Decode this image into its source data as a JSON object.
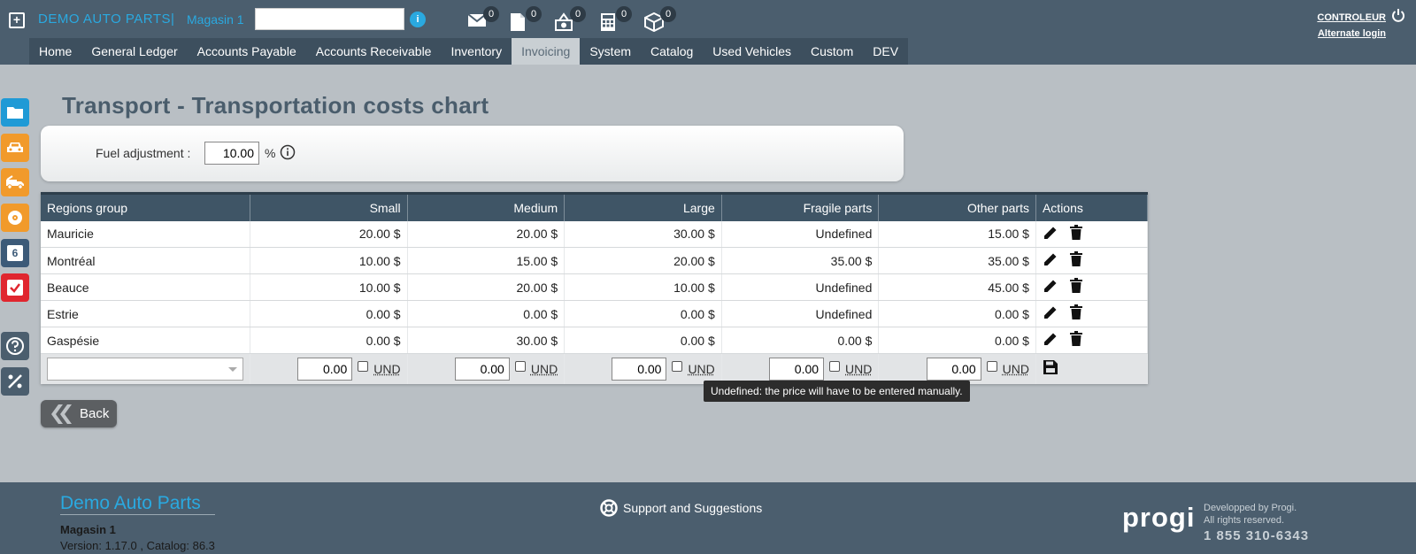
{
  "header": {
    "company": "DEMO AUTO PARTS",
    "separator": "|",
    "store": "Magasin 1",
    "search_value": "",
    "notifications": [
      {
        "icon": "mail-icon",
        "count": "0"
      },
      {
        "icon": "document-icon",
        "count": "0"
      },
      {
        "icon": "cash-icon",
        "count": "0"
      },
      {
        "icon": "calculator-icon",
        "count": "0"
      },
      {
        "icon": "package-icon",
        "count": "0"
      }
    ],
    "user": "CONTROLEUR",
    "alternate_login": "Alternate login"
  },
  "nav": {
    "items": [
      "Home",
      "General Ledger",
      "Accounts Payable",
      "Accounts Receivable",
      "Inventory",
      "Invoicing",
      "System",
      "Catalog",
      "Used Vehicles",
      "Custom",
      "DEV"
    ],
    "active": "Invoicing"
  },
  "sidebar": {
    "buttons": [
      {
        "icon": "folder-icon",
        "color": "#1f9ad6"
      },
      {
        "icon": "car-icon",
        "color": "#f19a2b"
      },
      {
        "icon": "tow-truck-icon",
        "color": "#f19a2b"
      },
      {
        "icon": "disc-icon",
        "color": "#f19a2b"
      },
      {
        "icon": "calendar-icon",
        "color": "#3c5a78"
      },
      {
        "icon": "checkbox-icon",
        "color": "#e0262f"
      },
      {
        "icon": "help-icon",
        "color": "#4b5e6e"
      },
      {
        "icon": "percent-icon",
        "color": "#4b5e6e"
      }
    ],
    "calendar_day": "6"
  },
  "page": {
    "title": "Transport - Transportation costs chart",
    "fuel_label": "Fuel adjustment :",
    "fuel_value": "10.00",
    "fuel_unit": "%"
  },
  "table": {
    "headers": [
      "Regions group",
      "Small",
      "Medium",
      "Large",
      "Fragile parts",
      "Other parts",
      "Actions"
    ],
    "rows": [
      {
        "region": "Mauricie",
        "small": "20.00 $",
        "medium": "20.00 $",
        "large": "30.00 $",
        "fragile": "Undefined",
        "other": "15.00 $"
      },
      {
        "region": "Montréal",
        "small": "10.00 $",
        "medium": "15.00 $",
        "large": "20.00 $",
        "fragile": "35.00 $",
        "other": "35.00 $"
      },
      {
        "region": "Beauce",
        "small": "10.00 $",
        "medium": "20.00 $",
        "large": "10.00 $",
        "fragile": "Undefined",
        "other": "45.00 $"
      },
      {
        "region": "Estrie",
        "small": "0.00 $",
        "medium": "0.00 $",
        "large": "0.00 $",
        "fragile": "Undefined",
        "other": "0.00 $"
      },
      {
        "region": "Gaspésie",
        "small": "0.00 $",
        "medium": "30.00 $",
        "large": "0.00 $",
        "fragile": "0.00 $",
        "other": "0.00 $"
      }
    ],
    "new_row": {
      "region_value": "",
      "values": [
        "0.00",
        "0.00",
        "0.00",
        "0.00",
        "0.00"
      ],
      "und_label": "UND"
    }
  },
  "tooltip": "Undefined: the price will have to be entered manually.",
  "back_label": "Back",
  "footer": {
    "company": "Demo Auto Parts",
    "store": "Magasin 1",
    "version": "Version:  1.17.0 ,  Catalog: 86.3",
    "support": "Support and Suggestions",
    "logo": "progi",
    "developed": "Developped by Progi.",
    "rights": "All rights reserved.",
    "phone": "1 855 310-6343"
  }
}
